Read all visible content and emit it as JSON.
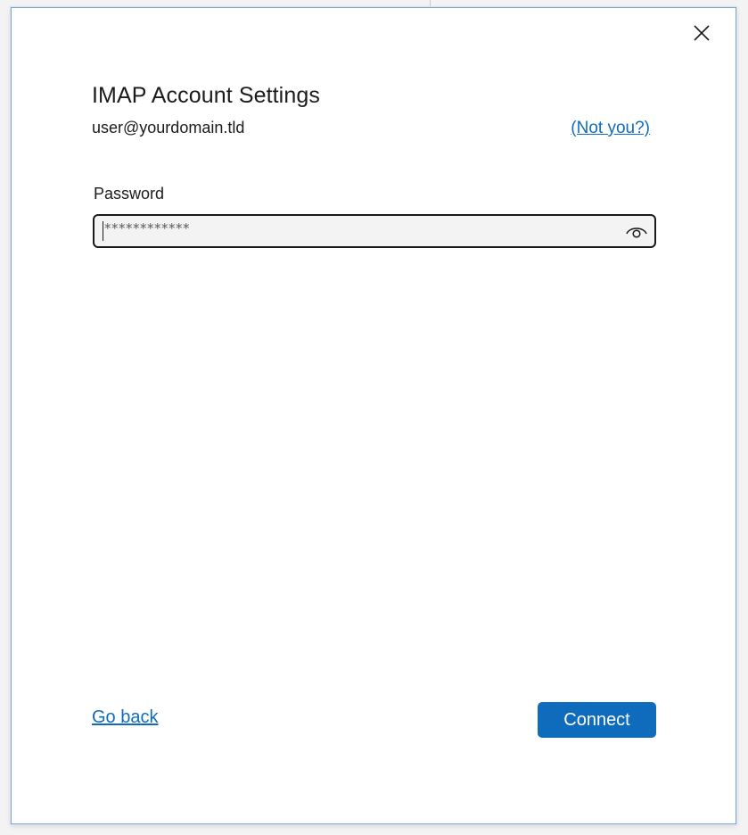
{
  "dialog": {
    "title": "IMAP Account Settings",
    "email": "user@yourdomain.tld",
    "not_you_link": "(Not you?)",
    "close_icon": "close-icon"
  },
  "password": {
    "label": "Password",
    "value": "************",
    "reveal_icon": "eye-icon"
  },
  "footer": {
    "go_back_link": "Go back",
    "connect_label": "Connect"
  },
  "colors": {
    "accent": "#0f6cbd",
    "text": "#1b1b1b",
    "field_bg": "#f3f3f3"
  }
}
